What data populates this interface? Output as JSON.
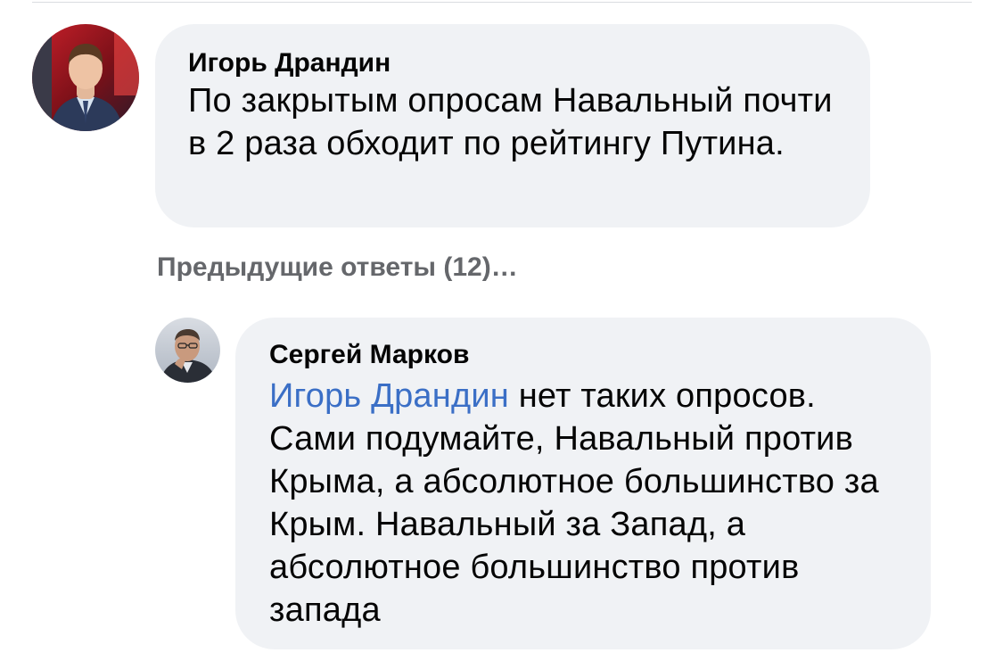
{
  "comments": [
    {
      "author": "Игорь Драндин",
      "text": "По закрытым опросам Навальный почти в 2 раза обходит по рейтингу Путина.",
      "avatar_icon": "user-avatar-man-in-suit"
    }
  ],
  "previous_replies": {
    "label": "Предыдущие ответы (12)…"
  },
  "replies": [
    {
      "author": "Сергей Марков",
      "mention": "Игорь Драндин",
      "text": " нет таких опросов. Сами подумайте, Навальный против Крыма, а абсолютное большинство за Крым. Навальный за Запад, а абсолютное большинство против запада",
      "avatar_icon": "user-avatar-man-glasses"
    }
  ],
  "colors": {
    "bubble_bg": "#f0f2f5",
    "mention": "#3b6fc6",
    "secondary_text": "#65676b"
  }
}
